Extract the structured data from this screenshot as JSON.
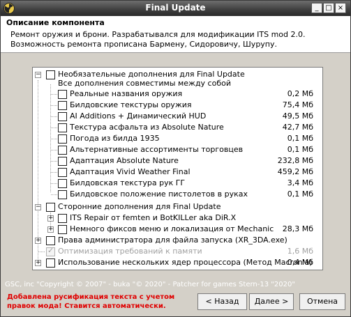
{
  "window": {
    "title": "Final Update"
  },
  "titlebar_buttons": {
    "minimize": "_",
    "maximize": "□",
    "close": "×"
  },
  "header": {
    "title": "Описание компонента",
    "description": "Ремонт оружия и брони. Разрабатывался для модификации ITS mod 2.0.\nВозможность ремонта прописана Бармену, Сидоровичу, Шурупу."
  },
  "tree": [
    {
      "label": "Необязательные дополнения для Final Update\nВсе дополнения совместимы между собой",
      "size": ""
    },
    {
      "label": "Реальные названия оружия",
      "size": "0,2 Мб"
    },
    {
      "label": "Билдовские текстуры оружия",
      "size": "75,4 Мб"
    },
    {
      "label": "AI Additions + Динамический HUD",
      "size": "49,5 Мб"
    },
    {
      "label": "Текстура асфальта из Absolute Nature",
      "size": "42,7 Мб"
    },
    {
      "label": "Погода из билда 1935",
      "size": "0,1 Мб"
    },
    {
      "label": "Альтернативные ассортименты торговцев",
      "size": "0,1 Мб"
    },
    {
      "label": "Адаптация Absolute Nature",
      "size": "232,8 Мб"
    },
    {
      "label": "Адаптация Vivid Weather Final",
      "size": "459,2 Мб"
    },
    {
      "label": "Билдовская текстура рук ГГ",
      "size": "3,4 Мб"
    },
    {
      "label": "Билдовское положение пистолетов в руках",
      "size": "0,1 Мб"
    },
    {
      "label": "Сторонние дополнения для Final Update",
      "size": ""
    },
    {
      "label": "ITS Repair от femten и BotKILLer aka DiR.X",
      "size": ""
    },
    {
      "label": "Немного фиксов меню и локализация от Mechanic",
      "size": "28,3 Мб"
    },
    {
      "label": "Права администратора для файла запуска (XR_3DA.exe)",
      "size": ""
    },
    {
      "label": "Оптимизация требований к памяти",
      "size": "1,6 Мб"
    },
    {
      "label": "Использование нескольких ядер процессора (Метод Macron'a)",
      "size": "0,4 Мб"
    }
  ],
  "footer": {
    "credits": "GSC, inc \"Copyright © 2007\" - buka \"© 2020\" - Patcher for games Stern-13 \"2020\"",
    "warning": "Добавлена русификация текста с учетом правок мода! Ставится автоматически."
  },
  "buttons": {
    "back": "< Назад",
    "next": "Далее >",
    "cancel": "Отмена"
  },
  "colors": {
    "warning_text": "#e00000",
    "titlebar": "#3e3e3e"
  }
}
